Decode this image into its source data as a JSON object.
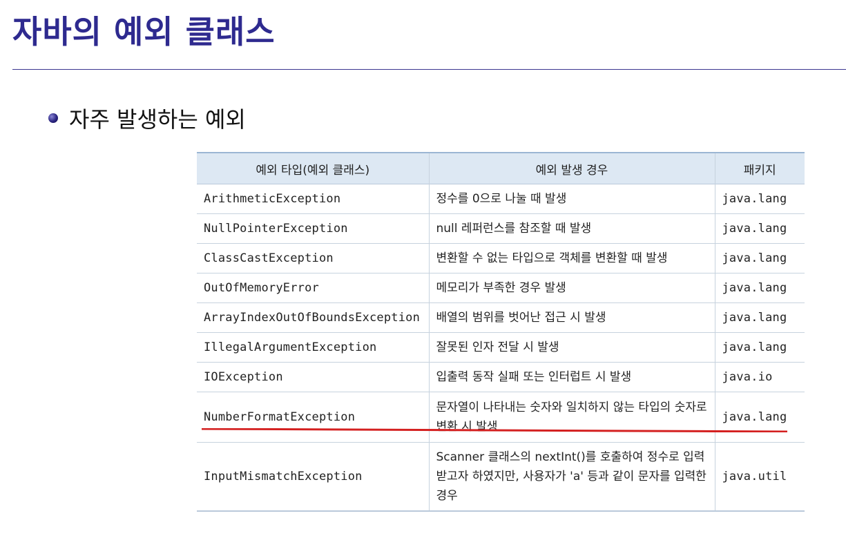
{
  "slide": {
    "title": "자바의 예외 클래스"
  },
  "bullet": {
    "text": "자주 발생하는 예외"
  },
  "table": {
    "headers": [
      "예외 타입(예외 클래스)",
      "예외 발생 경우",
      "패키지"
    ],
    "rows": [
      {
        "type": "ArithmeticException",
        "cond": "정수를 0으로 나눌 때 발생",
        "pkg": "java.lang"
      },
      {
        "type": "NullPointerException",
        "cond": "null 레퍼런스를 참조할 때 발생",
        "pkg": "java.lang"
      },
      {
        "type": "ClassCastException",
        "cond": "변환할 수 없는 타입으로 객체를 변환할 때 발생",
        "pkg": "java.lang"
      },
      {
        "type": "OutOfMemoryError",
        "cond": "메모리가 부족한 경우 발생",
        "pkg": "java.lang"
      },
      {
        "type": "ArrayIndexOutOfBoundsException",
        "cond": "배열의 범위를 벗어난 접근 시 발생",
        "pkg": "java.lang"
      },
      {
        "type": "IllegalArgumentException",
        "cond": "잘못된 인자 전달 시 발생",
        "pkg": "java.lang"
      },
      {
        "type": "IOException",
        "cond": "입출력 동작 실패 또는 인터럽트 시 발생",
        "pkg": "java.io"
      },
      {
        "type": "NumberFormatException",
        "cond": "문자열이 나타내는 숫자와 일치하지 않는 타입의 숫자로 변환 시 발생",
        "pkg": "java.lang"
      },
      {
        "type": "InputMismatchException",
        "cond": "Scanner 클래스의 nextInt()를 호출하여 정수로 입력받고자 하였지만, 사용자가 'a' 등과 같이 문자를 입력한 경우",
        "pkg": "java.util"
      }
    ]
  },
  "colors": {
    "title": "#2e2a8f",
    "header_bg": "#dde8f3",
    "annotation_underline": "#d42020"
  }
}
